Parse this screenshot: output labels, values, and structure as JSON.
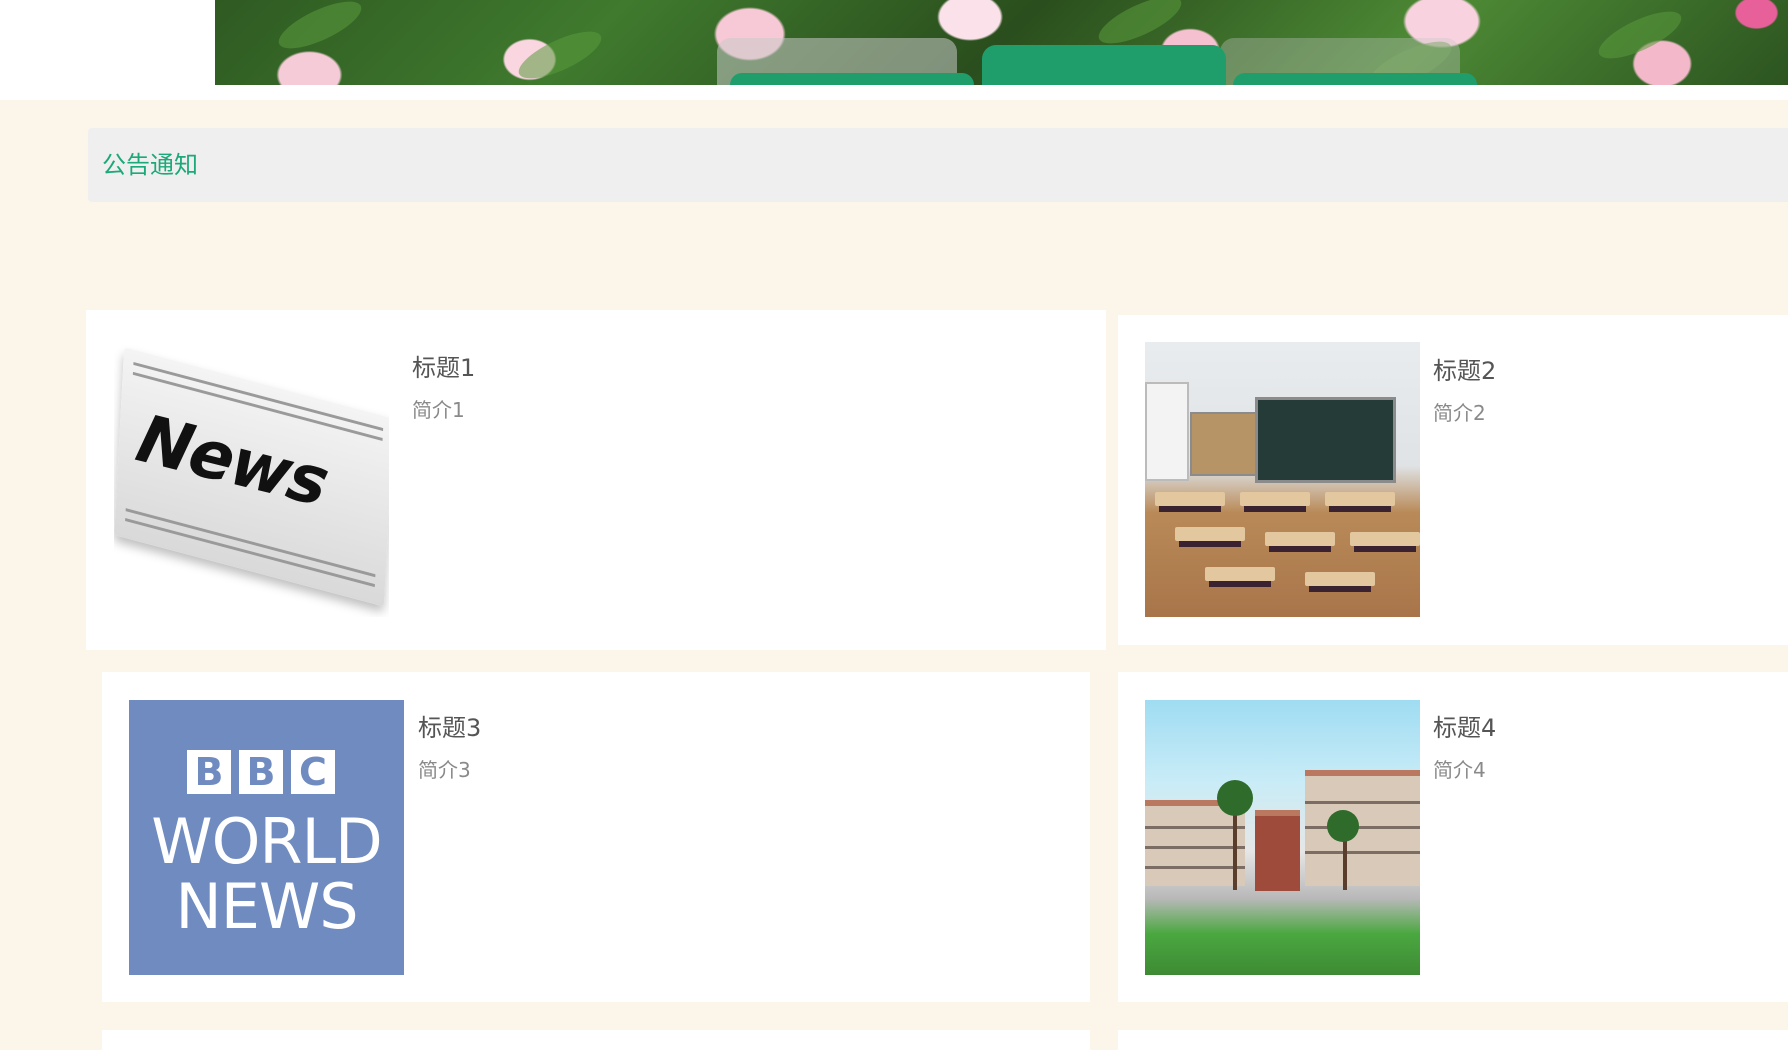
{
  "header": {
    "banner_name": "peony-flower-banner",
    "nav_tabs": [
      {
        "label": ""
      },
      {
        "label": ""
      },
      {
        "label": ""
      }
    ]
  },
  "notice": {
    "title": "公告通知"
  },
  "news": [
    {
      "title": "标题1",
      "intro": "简介1",
      "image": "news-newspaper"
    },
    {
      "title": "标题2",
      "intro": "简介2",
      "image": "classroom-photo"
    },
    {
      "title": "标题3",
      "intro": "简介3",
      "image": "bbc-world-news-logo"
    },
    {
      "title": "标题4",
      "intro": "简介4",
      "image": "campus-building-photo"
    }
  ],
  "logos": {
    "news_word": "News",
    "bbc_letters": [
      "B",
      "B",
      "C"
    ],
    "bbc_line1": "WORLD",
    "bbc_line2": "NEWS"
  },
  "colors": {
    "accent_green": "#1ba979",
    "nav_green": "#1f9e6c",
    "page_bg": "#fcf5ea",
    "notice_bg": "#efefef",
    "bbc_blue": "#6f8bc0"
  }
}
